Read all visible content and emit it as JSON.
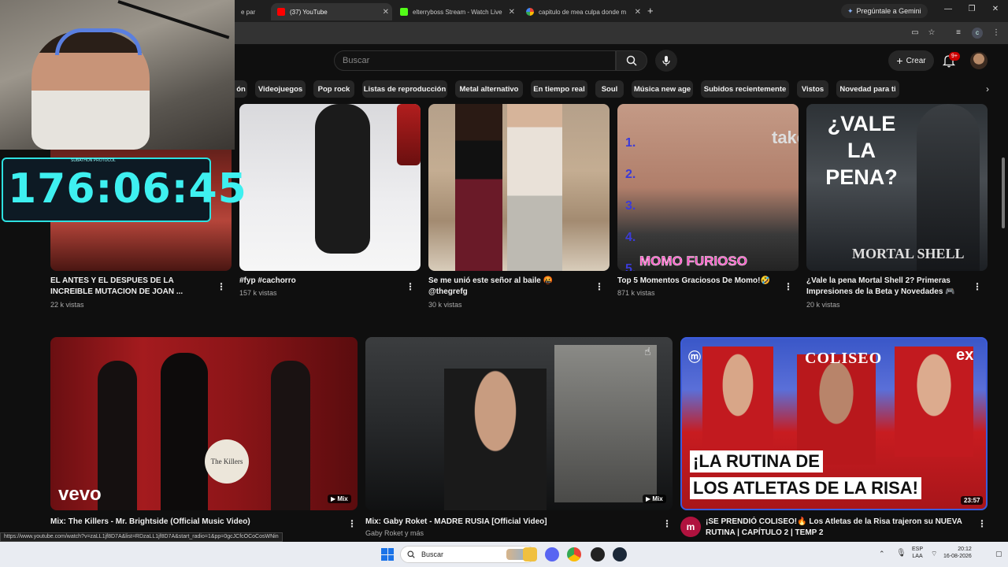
{
  "browser": {
    "tabs": [
      {
        "label": "e par",
        "active": false
      },
      {
        "label": "(37) YouTube",
        "active": true
      },
      {
        "label": "elterryboss Stream - Watch Live",
        "active": false
      },
      {
        "label": "capitulo de mea culpa donde m",
        "active": false
      }
    ],
    "new_tab": "+",
    "gemini_label": "Pregúntale a Gemini",
    "profile_initial": "c"
  },
  "youtube": {
    "search_placeholder": "Buscar",
    "create_label": "Crear",
    "notification_count": "9+",
    "chips": [
      "ón",
      "Videojuegos",
      "Pop rock",
      "Listas de reproducción",
      "Metal alternativo",
      "En tiempo real",
      "Soul",
      "Música new age",
      "Subidos recientemente",
      "Vistos",
      "Novedad para ti"
    ],
    "row1": [
      {
        "title": "EL ANTES Y EL DESPUES DE LA INCREIBLE MUTACION DE JOAN ...",
        "meta": "22 k vistas"
      },
      {
        "title": "#fyp #cachorro",
        "meta": "157 k vistas"
      },
      {
        "title": "Se me unió este señor al baile 🤬 @thegrefg",
        "meta": "30 k vistas"
      },
      {
        "title": "Top 5 Momentos Graciosos De Momo!🤣",
        "meta": "871 k vistas",
        "thumb_text": "MOMO FURIOSO",
        "numbers": [
          "1.",
          "2.",
          "3.",
          "4.",
          "5."
        ],
        "brand_partial": "take"
      },
      {
        "title": "¿Vale la pena Mortal Shell 2? Primeras Impresiones de la Beta y Novedades 🎮",
        "meta": "20 k vistas",
        "thumb_text": "¿VALE LA PENA?",
        "logo_text": "MORTAL SHELL"
      }
    ],
    "row2": [
      {
        "title": "Mix: The Killers - Mr. Brightside (Official Music Video)",
        "meta": "",
        "badge": "Mix",
        "logo_text": "vevo",
        "drum_text": "The Killers"
      },
      {
        "title": "Mix: Gaby Roket - MADRE RUSIA [Official Video]",
        "meta": "Gaby Roket y más",
        "badge": "Mix"
      },
      {
        "title": "¡SE PRENDIÓ COLISEO!🔥 Los Atletas de la Risa trajeron su NUEVA RUTINA | CAPÍTULO 2 | TEMP 2",
        "meta": "",
        "duration": "23:57",
        "thumb_line1": "¡LA RUTINA DE",
        "thumb_line2": "LOS ATLETAS DE LA RISA!",
        "show_name": "COLISEO",
        "channel_logo": "ex"
      }
    ]
  },
  "overlay": {
    "timer": "176:06:45",
    "timer_label": "SUBATHON PROTOCOL"
  },
  "status_url": "https://www.youtube.com/watch?v=zaLL1jf8D7A&list=RDzaLL1jf8D7A&start_radio=1&pp=0gcJCfcOCoCosWNin",
  "taskbar": {
    "search_label": "Buscar",
    "lang_line1": "ESP",
    "lang_line2": "LAA",
    "time": "20:12",
    "date": "16-08-2026"
  },
  "colors": {
    "yt_bg": "#0f0f0f",
    "chip_bg": "#272727",
    "accent_red": "#cc0000",
    "timer_cyan": "#3ef0f0"
  }
}
